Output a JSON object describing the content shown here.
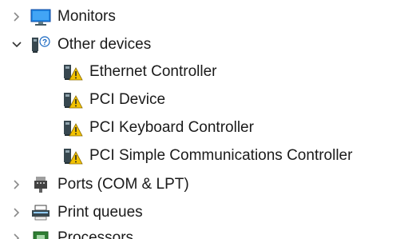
{
  "tree": {
    "items": [
      {
        "label": "Monitors",
        "state": "collapsed",
        "icon": "monitor-icon"
      },
      {
        "label": "Other devices",
        "state": "expanded",
        "icon": "unknown-device-icon",
        "children": [
          {
            "label": "Ethernet Controller",
            "icon": "warning-device-icon"
          },
          {
            "label": "PCI Device",
            "icon": "warning-device-icon"
          },
          {
            "label": "PCI Keyboard Controller",
            "icon": "warning-device-icon"
          },
          {
            "label": "PCI Simple Communications Controller",
            "icon": "warning-device-icon"
          }
        ]
      },
      {
        "label": "Ports (COM & LPT)",
        "state": "collapsed",
        "icon": "port-icon"
      },
      {
        "label": "Print queues",
        "state": "collapsed",
        "icon": "printer-icon"
      },
      {
        "label": "Processors",
        "state": "collapsed",
        "icon": "processor-icon"
      }
    ]
  },
  "colors": {
    "chevron": "#8a8a8a",
    "text": "#1a1a1a",
    "warning": "#f2c200"
  }
}
